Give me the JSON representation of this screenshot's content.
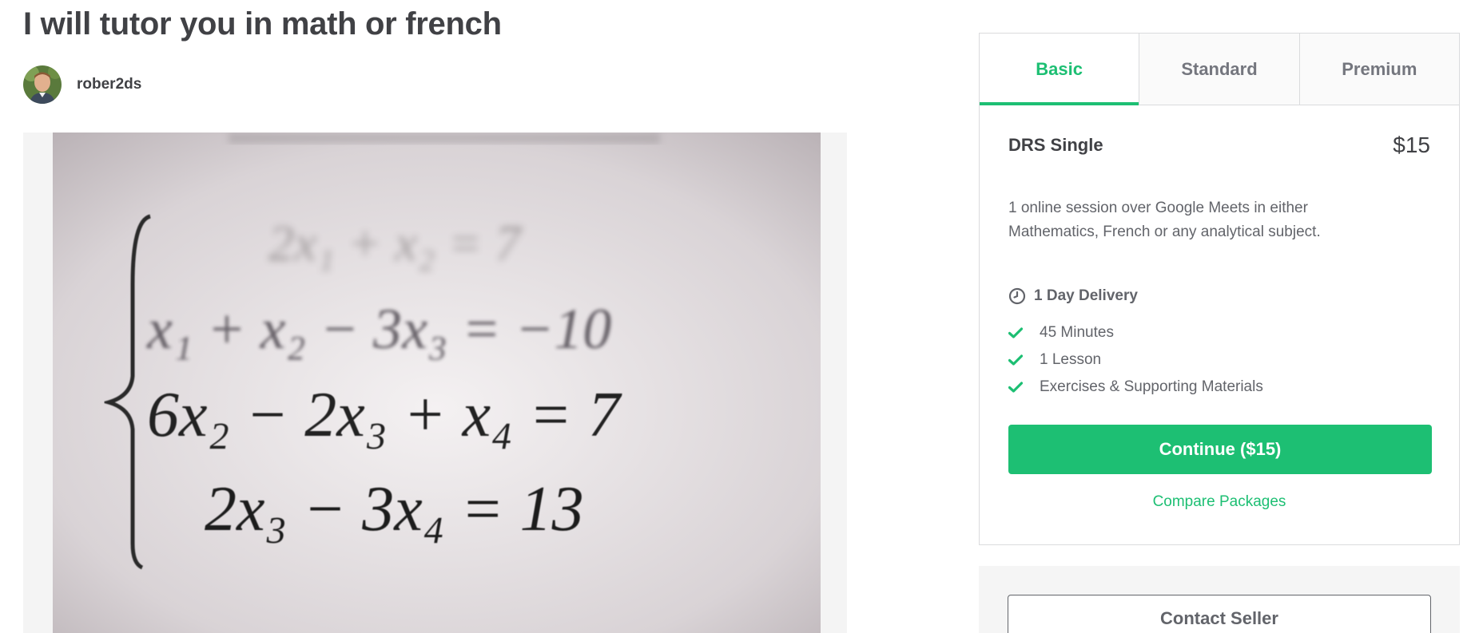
{
  "gig": {
    "title": "I will tutor you in math or french"
  },
  "seller": {
    "username": "rober2ds",
    "avatar_icon": "person-avatar"
  },
  "gallery": {
    "image_icon": "linear-equations-photo",
    "equations": [
      "2x₁ + x₂ = 7",
      "x₁ + x₂ − 3x₃ = −10",
      "6x₂ − 2x₃ + x₄ = 7",
      "2x₃ − 3x₄ = 13"
    ]
  },
  "packages": {
    "tabs": [
      {
        "label": "Basic",
        "active": true
      },
      {
        "label": "Standard",
        "active": false
      },
      {
        "label": "Premium",
        "active": false
      }
    ],
    "selected": {
      "name": "DRS Single",
      "price": "$15",
      "description": "1 online session over Google Meets in either Mathematics, French or any analytical subject.",
      "delivery": "1 Day Delivery",
      "delivery_icon": "clock-icon",
      "features": [
        "45 Minutes",
        "1 Lesson",
        "Exercises & Supporting Materials"
      ],
      "feature_icon": "check-icon",
      "continue_label": "Continue ($15)",
      "compare_label": "Compare Packages"
    }
  },
  "contact": {
    "label": "Contact Seller"
  },
  "colors": {
    "accent": "#1dbf73",
    "text_dark": "#404145",
    "text_muted": "#62646a",
    "border": "#dadbdd"
  }
}
